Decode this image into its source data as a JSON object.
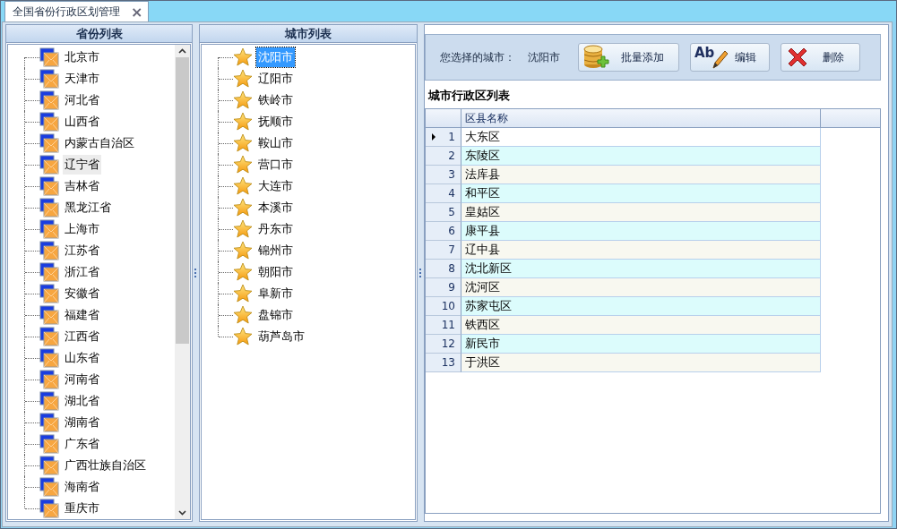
{
  "tab": {
    "label": "全国省份行政区划管理",
    "close": "×"
  },
  "provinces": {
    "title": "省份列表",
    "items": [
      {
        "name": "北京市",
        "selected": false
      },
      {
        "name": "天津市",
        "selected": false
      },
      {
        "name": "河北省",
        "selected": false
      },
      {
        "name": "山西省",
        "selected": false
      },
      {
        "name": "内蒙古自治区",
        "selected": false
      },
      {
        "name": "辽宁省",
        "selected": true
      },
      {
        "name": "吉林省",
        "selected": false
      },
      {
        "name": "黑龙江省",
        "selected": false
      },
      {
        "name": "上海市",
        "selected": false
      },
      {
        "name": "江苏省",
        "selected": false
      },
      {
        "name": "浙江省",
        "selected": false
      },
      {
        "name": "安徽省",
        "selected": false
      },
      {
        "name": "福建省",
        "selected": false
      },
      {
        "name": "江西省",
        "selected": false
      },
      {
        "name": "山东省",
        "selected": false
      },
      {
        "name": "河南省",
        "selected": false
      },
      {
        "name": "湖北省",
        "selected": false
      },
      {
        "name": "湖南省",
        "selected": false
      },
      {
        "name": "广东省",
        "selected": false
      },
      {
        "name": "广西壮族自治区",
        "selected": false
      },
      {
        "name": "海南省",
        "selected": false
      },
      {
        "name": "重庆市",
        "selected": false
      }
    ]
  },
  "cities": {
    "title": "城市列表",
    "items": [
      {
        "name": "沈阳市",
        "selected": true
      },
      {
        "name": "辽阳市",
        "selected": false
      },
      {
        "name": "铁岭市",
        "selected": false
      },
      {
        "name": "抚顺市",
        "selected": false
      },
      {
        "name": "鞍山市",
        "selected": false
      },
      {
        "name": "营口市",
        "selected": false
      },
      {
        "name": "大连市",
        "selected": false
      },
      {
        "name": "本溪市",
        "selected": false
      },
      {
        "name": "丹东市",
        "selected": false
      },
      {
        "name": "锦州市",
        "selected": false
      },
      {
        "name": "朝阳市",
        "selected": false
      },
      {
        "name": "阜新市",
        "selected": false
      },
      {
        "name": "盘锦市",
        "selected": false
      },
      {
        "name": "葫芦岛市",
        "selected": false
      }
    ]
  },
  "toolbar": {
    "label": "您选择的城市：",
    "city": "沈阳市",
    "buttons": [
      {
        "kind": "add",
        "label": "批量添加"
      },
      {
        "kind": "edit",
        "label": "编辑",
        "icon_text": "Ab"
      },
      {
        "kind": "delete",
        "label": "删除"
      }
    ]
  },
  "districts": {
    "title": "城市行政区列表",
    "columns": [
      "区县名称"
    ],
    "rows": [
      {
        "index": "1",
        "name": "大东区",
        "current": true
      },
      {
        "index": "2",
        "name": "东陵区",
        "current": false
      },
      {
        "index": "3",
        "name": "法库县",
        "current": false
      },
      {
        "index": "4",
        "name": "和平区",
        "current": false
      },
      {
        "index": "5",
        "name": "皇姑区",
        "current": false
      },
      {
        "index": "6",
        "name": "康平县",
        "current": false
      },
      {
        "index": "7",
        "name": "辽中县",
        "current": false
      },
      {
        "index": "8",
        "name": "沈北新区",
        "current": false
      },
      {
        "index": "9",
        "name": "沈河区",
        "current": false
      },
      {
        "index": "10",
        "name": "苏家屯区",
        "current": false
      },
      {
        "index": "11",
        "name": "铁西区",
        "current": false
      },
      {
        "index": "12",
        "name": "新民市",
        "current": false
      },
      {
        "index": "13",
        "name": "于洪区",
        "current": false
      }
    ]
  }
}
